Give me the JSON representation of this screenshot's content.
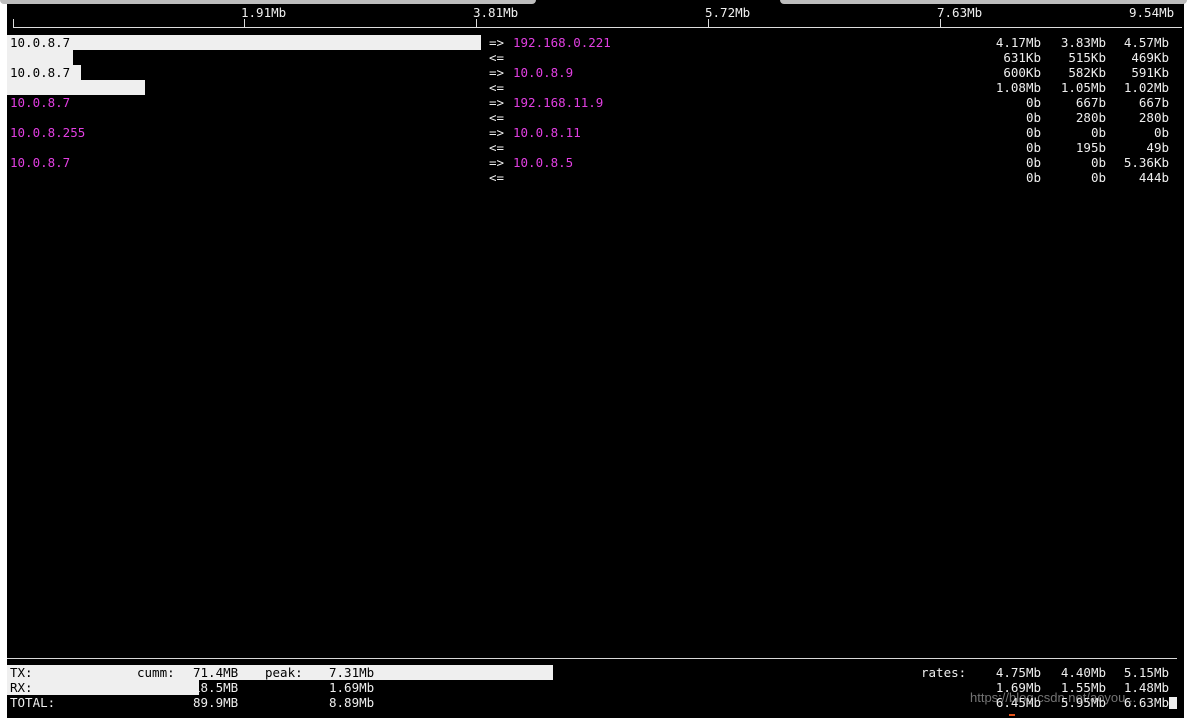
{
  "scale": {
    "labels": [
      "1.91Mb",
      "3.81Mb",
      "5.72Mb",
      "7.63Mb",
      "9.54Mb"
    ]
  },
  "connections": [
    {
      "host": "10.0.8.7",
      "peer": "192.168.0.221",
      "send": [
        "4.17Mb",
        "3.83Mb",
        "4.57Mb"
      ],
      "recv": [
        "631Kb",
        "515Kb",
        "469Kb"
      ]
    },
    {
      "host": "10.0.8.7",
      "peer": "10.0.8.9",
      "send": [
        "600Kb",
        "582Kb",
        "591Kb"
      ],
      "recv": [
        "1.08Mb",
        "1.05Mb",
        "1.02Mb"
      ]
    },
    {
      "host": "10.0.8.7",
      "peer": "192.168.11.9",
      "send": [
        "0b",
        "667b",
        "667b"
      ],
      "recv": [
        "0b",
        "280b",
        "280b"
      ]
    },
    {
      "host": "10.0.8.255",
      "peer": "10.0.8.11",
      "send": [
        "0b",
        "0b",
        "0b"
      ],
      "recv": [
        "0b",
        "195b",
        "49b"
      ]
    },
    {
      "host": "10.0.8.7",
      "peer": "10.0.8.5",
      "send": [
        "0b",
        "0b",
        "5.36Kb"
      ],
      "recv": [
        "0b",
        "0b",
        "444b"
      ]
    }
  ],
  "directions": {
    "send": "=>",
    "recv": "<="
  },
  "footer": {
    "tx_label": "TX:",
    "rx_label": "RX:",
    "total_label": "TOTAL:",
    "cumm_label": "cumm:",
    "peak_label": "peak:",
    "tx_cumm": "71.4MB",
    "tx_peak": "7.31Mb",
    "rx_cumm": "18.5MB",
    "rx_peak": "1.69Mb",
    "total_cumm": "89.9MB",
    "total_peak": "8.89Mb",
    "rates_label": "rates:",
    "tx_rates": [
      "4.75Mb",
      "4.40Mb",
      "5.15Mb"
    ],
    "rx_rates": [
      "1.69Mb",
      "1.55Mb",
      "1.48Mb"
    ],
    "total_rates": [
      "6.45Mb",
      "5.95Mb",
      "6.63Mb"
    ]
  },
  "watermark": "https://blog.csdn.net/aoyou..."
}
